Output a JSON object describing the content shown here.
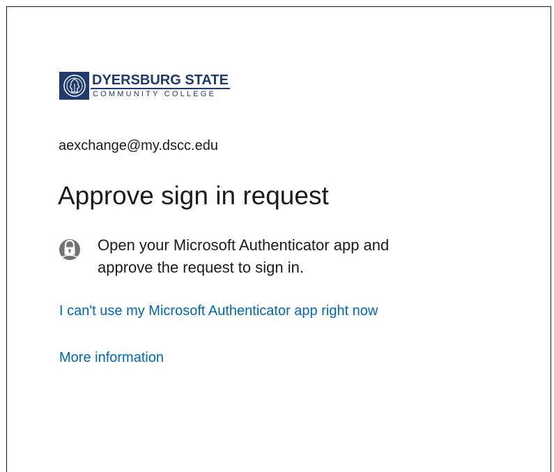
{
  "org": {
    "name_line1": "DYERSBURG STATE",
    "name_line2": "COMMUNITY COLLEGE",
    "brand_color": "#1f3a6e"
  },
  "account": {
    "email": "aexchange@my.dscc.edu"
  },
  "page": {
    "title": "Approve sign in request",
    "prompt_line1": "Open your Microsoft Authenticator app and",
    "prompt_line2": "approve the request to sign in.",
    "prompt_icon": "lock-icon"
  },
  "links": {
    "cant_use": "I can't use my Microsoft Authenticator app right now",
    "more_info": "More information",
    "color": "#0067b8"
  }
}
